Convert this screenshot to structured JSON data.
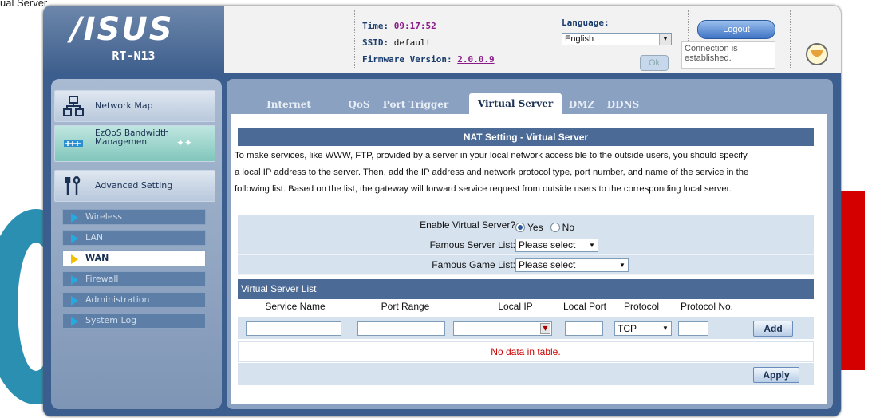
{
  "corner_text": "ual Server",
  "header": {
    "logo_text": "/ISUS",
    "model": "RT-N13",
    "time_label": "Time:",
    "time_value": "09:17:52",
    "ssid_label": "SSID:",
    "ssid_value": "default",
    "firmware_label": "Firmware Version:",
    "firmware_value": "2.0.0.9",
    "language_label": "Language:",
    "language_value": "English",
    "ok_label": "Ok",
    "logout_label": "Logout",
    "connection_status": "Connection is established."
  },
  "sidebar": {
    "items": [
      {
        "label": "Network Map",
        "icon": "network-map-icon"
      },
      {
        "label": "EzQoS Bandwidth Management",
        "icon": "bandwidth-icon"
      },
      {
        "label": "Advanced Setting",
        "icon": "wrench-icon"
      }
    ],
    "sub_items": [
      "Wireless",
      "LAN",
      "WAN",
      "Firewall",
      "Administration",
      "System Log"
    ],
    "active_sub": "WAN"
  },
  "tabs": [
    "Internet Connection",
    "QoS",
    "Port Trigger",
    "Virtual Server",
    "DMZ",
    "DDNS"
  ],
  "active_tab": "Virtual Server",
  "section": {
    "title": "NAT Setting - Virtual Server",
    "description": [
      "To make services, like WWW, FTP, provided by a server in your local network accessible to the outside users, you should specify",
      "a local IP address to the server. Then, add the IP address and network protocol type, port number, and name of the service in the",
      "following list. Based on the list, the gateway will forward service request from outside users to the corresponding local server."
    ]
  },
  "form": {
    "enable_label": "Enable Virtual Server?",
    "yes_label": "Yes",
    "no_label": "No",
    "enable_value": "Yes",
    "famous_server_label": "Famous Server List:",
    "famous_server_value": "Please select",
    "famous_game_label": "Famous Game List:",
    "famous_game_value": "Please select"
  },
  "list": {
    "title": "Virtual Server List",
    "columns": [
      "Service Name",
      "Port Range",
      "Local IP",
      "Local Port",
      "Protocol",
      "Protocol No."
    ],
    "protocol_value": "TCP",
    "add_label": "Add",
    "empty_text": "No data in table.",
    "apply_label": "Apply"
  },
  "colors": {
    "frame": "#3c5e8e",
    "header_bar": "#4b6a96",
    "row_bg": "#d6e2ee",
    "empty_text": "#cc0000"
  }
}
